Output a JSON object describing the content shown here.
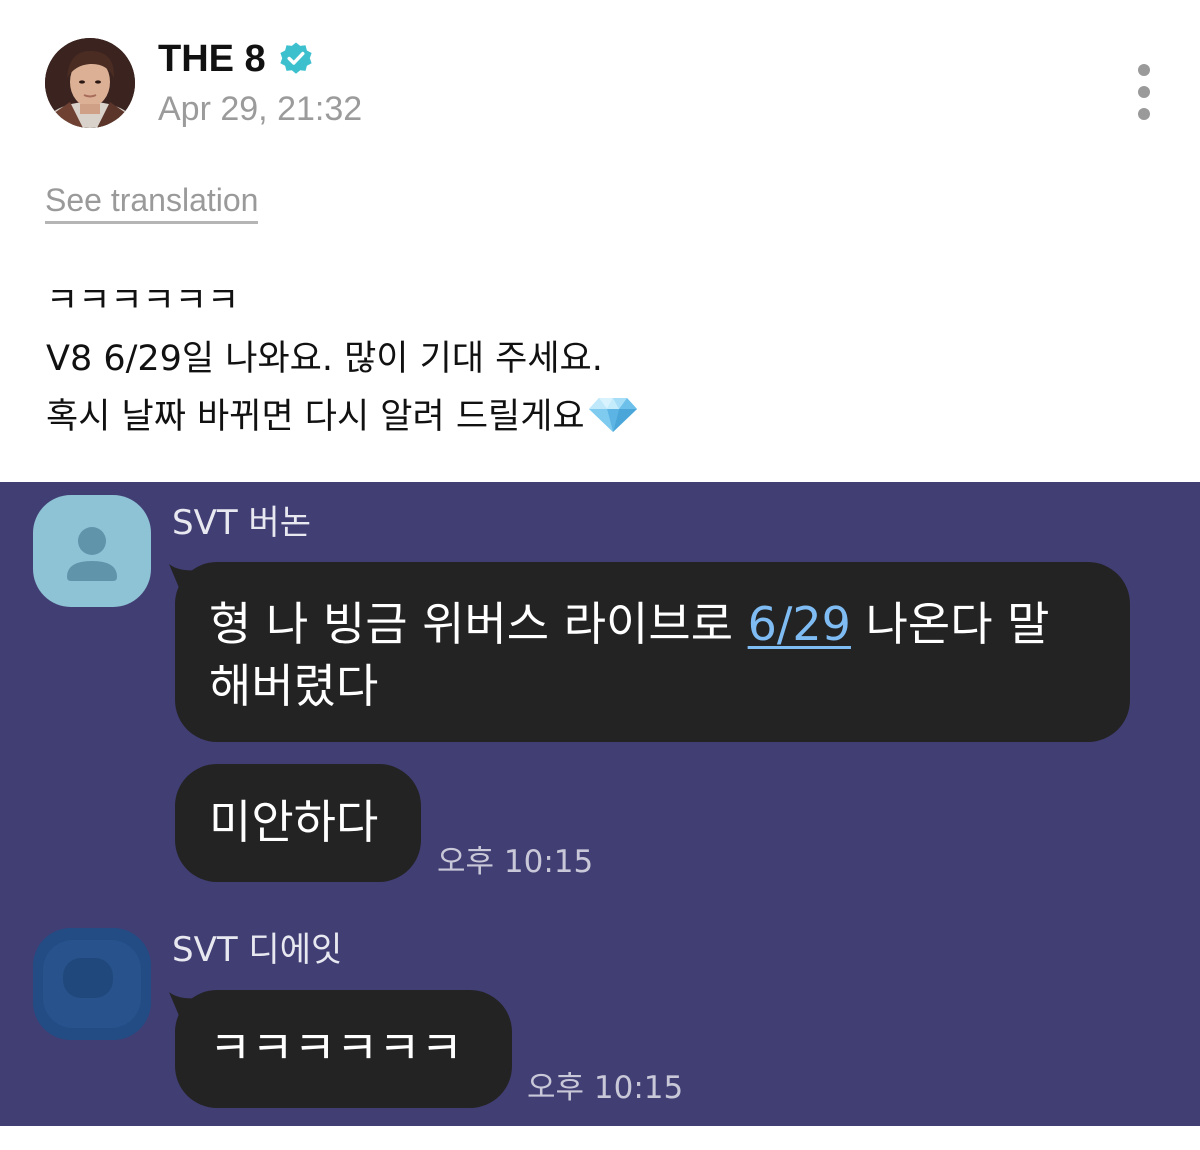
{
  "post": {
    "author": "THE 8",
    "verified": true,
    "timestamp": "Apr 29, 21:32",
    "see_translation": "See translation",
    "more_icon": "more-vertical-icon",
    "lines": [
      "ㅋㅋㅋㅋㅋㅋ",
      "V8 6/29일 나와요. 많이 기대 주세요.",
      "혹시 날짜 바뀌면 다시 알려 드릴게요"
    ],
    "emoji": "diamond-emoji"
  },
  "chat": {
    "background_color": "#413e74",
    "bubble_color": "#232323",
    "link_color": "#7fbcf3",
    "messages": [
      {
        "sender": "SVT 버논",
        "bubbles": [
          {
            "text_before": "형 나 빙금 위버스 라이브로 ",
            "link": "6/29",
            "text_after": " 나온다 말",
            "line2": "해버렸다"
          },
          {
            "text": "미안하다",
            "time": "오후 10:15"
          }
        ]
      },
      {
        "sender": "SVT 디에잇",
        "bubbles": [
          {
            "text": "ㅋㅋㅋㅋㅋㅋ",
            "time": "오후 10:15"
          }
        ]
      }
    ]
  }
}
